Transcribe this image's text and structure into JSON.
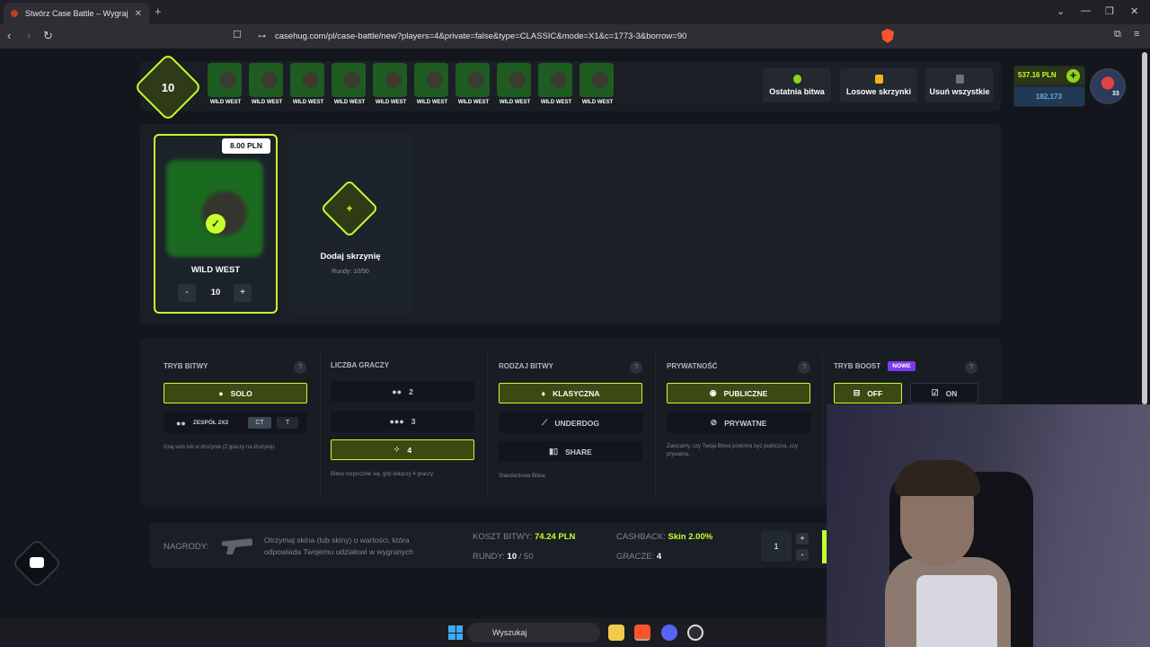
{
  "browser": {
    "tab_title": "Stwórz Case Battle – Wygraj skin",
    "url": "casehug.com/pl/case-battle/new?players=4&private=false&type=CLASSIC&mode=X1&c=1773-3&borrow=90"
  },
  "header": {
    "rounds": "10",
    "cases": [
      "WILD WEST",
      "WILD WEST",
      "WILD WEST",
      "WILD WEST",
      "WILD WEST",
      "WILD WEST",
      "WILD WEST",
      "WILD WEST",
      "WILD WEST",
      "WILD WEST"
    ],
    "last_battle": "Ostatnia bitwa",
    "random_cases": "Losowe skrzynki",
    "remove_all": "Usuń wszystkie",
    "balance": "537.16 PLN",
    "coins": "182,173",
    "level": "33"
  },
  "case_card": {
    "price": "8.00 PLN",
    "name": "WILD WEST",
    "qty": "10",
    "minus": "-",
    "plus": "+"
  },
  "add_case": {
    "label": "Dodaj skrzynię",
    "rounds": "Rundy: 10/50",
    "plus": "+"
  },
  "settings": {
    "mode": {
      "title": "TRYB BITWY",
      "solo": "SOLO",
      "team": "ZESPÓŁ 2X2",
      "ct": "CT",
      "t": "T",
      "note": "Graj solo lub w drużynie (2 graczy na drużynę)"
    },
    "players": {
      "title": "LICZBA GRACZY",
      "options": [
        "2",
        "3",
        "4"
      ],
      "note": "Bitwa rozpocznie się, gdy dołączy 4 graczy"
    },
    "type": {
      "title": "RODZAJ BITWY",
      "options": [
        "KLASYCZNA",
        "UNDERDOG",
        "SHARE"
      ],
      "note": "Standardowa Bitwa"
    },
    "privacy": {
      "title": "PRYWATNOŚĆ",
      "options": [
        "PUBLICZNE",
        "PRYWATNE"
      ],
      "note": "Zalecamy, czy Twoja Bitwa powinna być publiczna, czy prywatna."
    },
    "boost": {
      "title": "TRYB BOOST",
      "badge": "NOWE",
      "off": "OFF",
      "on": "ON"
    },
    "help": "?"
  },
  "footer": {
    "prizes_label": "NAGRODY:",
    "prizes_text_1": "Otrzymaj skina (lub skiny) o wartości, która",
    "prizes_text_2": "odpowiada Twojemu udziałowi w wygranych",
    "cost_label": "KOSZT BITWY:",
    "cost_value": "74.24 PLN",
    "rounds_label": "RUNDY:",
    "rounds_value": "10",
    "rounds_total": "/ 50",
    "cashback_label": "CASHBACK:",
    "cashback_value": "Skin 2.00%",
    "players_label": "GRACZE:",
    "players_value": "4",
    "qty": "1",
    "plus": "+",
    "minus": "-"
  },
  "taskbar": {
    "search": "Wyszukaj"
  },
  "colors": {
    "accent": "#c7ff2e",
    "background": "#13161c",
    "panel": "#1a1e25",
    "badge": "#7c3aed"
  }
}
